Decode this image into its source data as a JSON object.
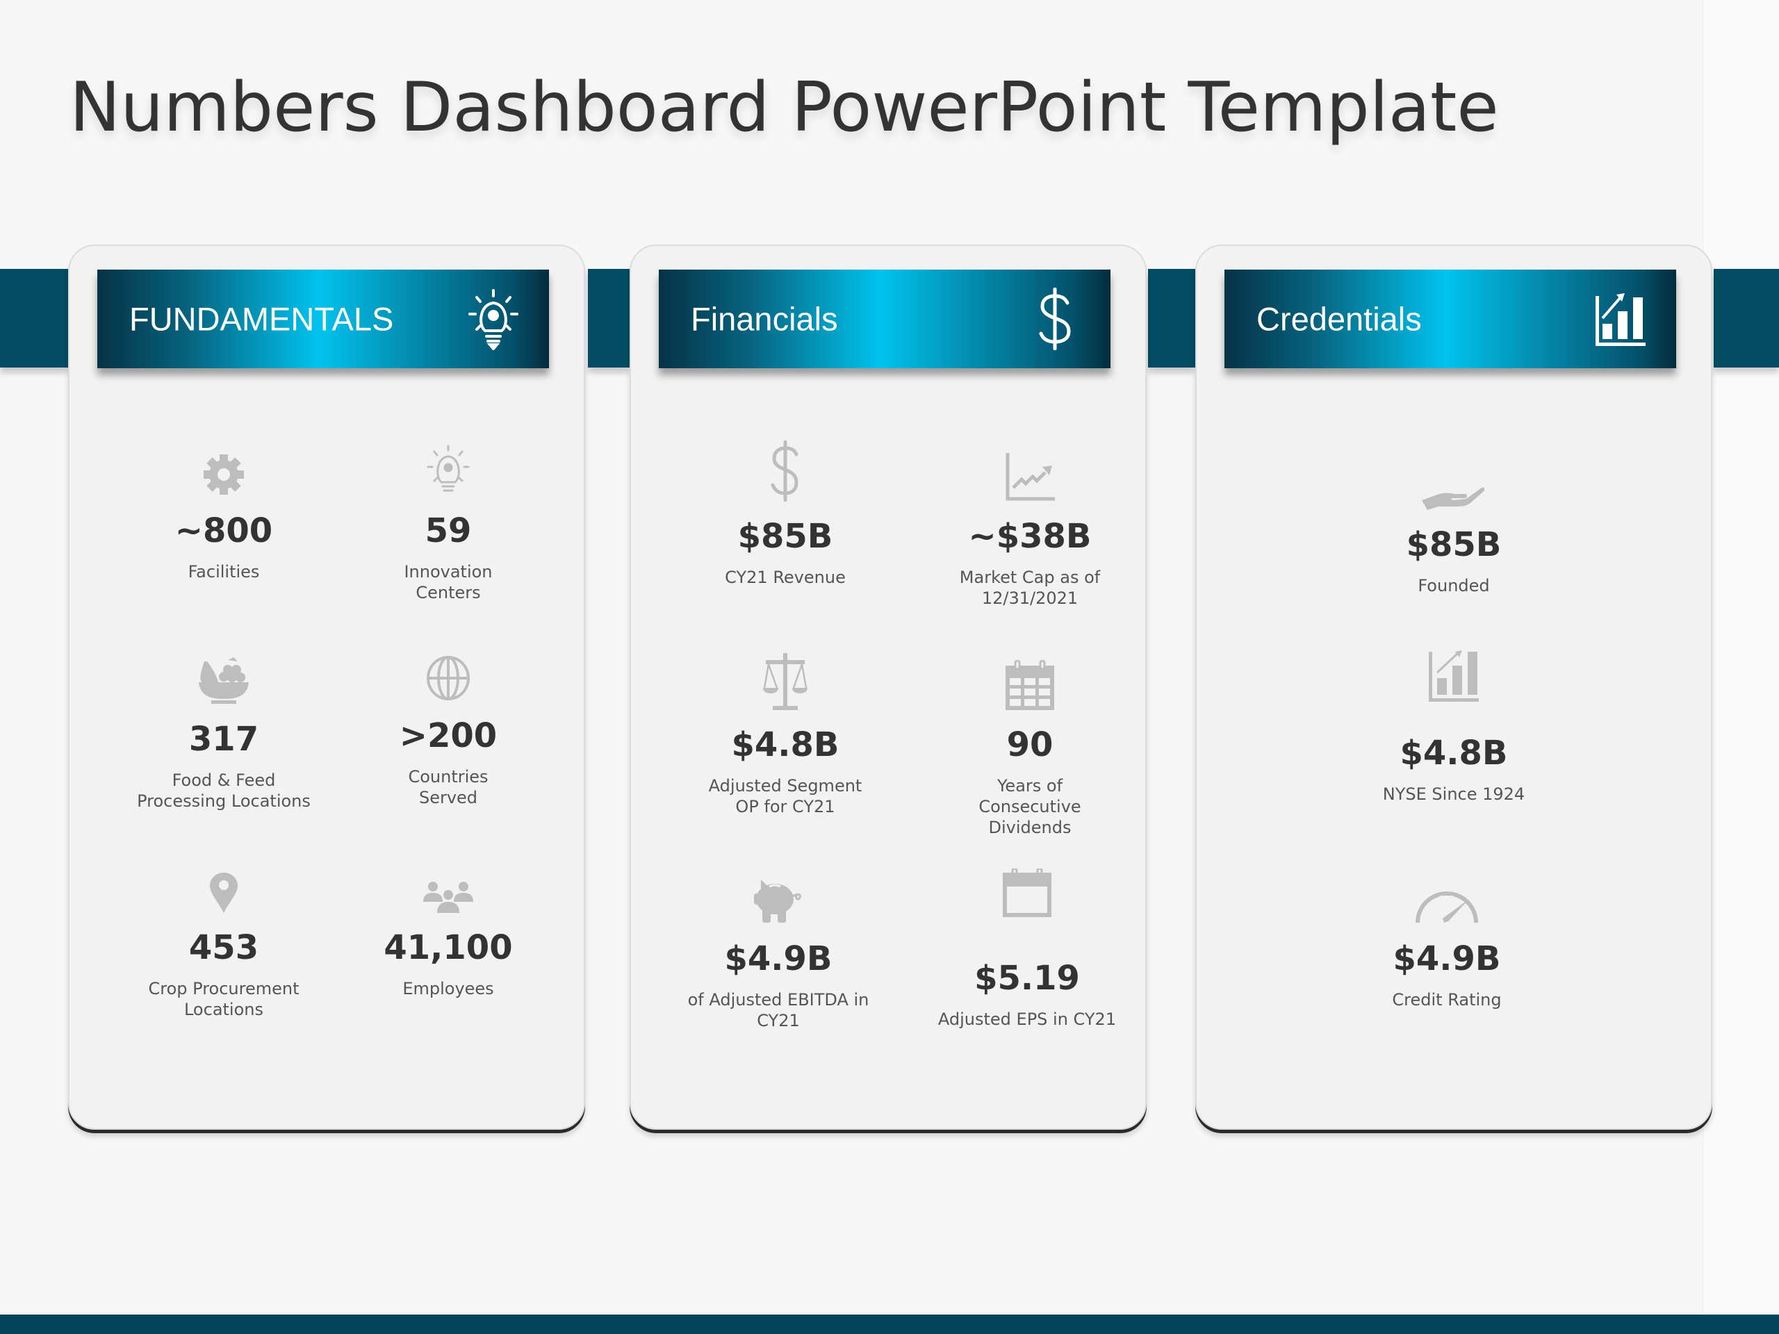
{
  "title": "Numbers Dashboard PowerPoint Template",
  "colors": {
    "accent_dark": "#044c63",
    "accent_bright": "#00c3ee",
    "icon_gray": "#bdbdbd",
    "value_text": "#333333",
    "label_text": "#555555"
  },
  "cards": [
    {
      "title": "FUNDAMENTALS",
      "icon": "lightbulb-gear-icon",
      "stats": [
        {
          "icon": "gear-icon",
          "value": "~800",
          "label": "Facilities"
        },
        {
          "icon": "lightbulb-icon",
          "value": "59",
          "label": "Innovation\nCenters"
        },
        {
          "icon": "fruit-bowl-icon",
          "value": "317",
          "label": "Food & Feed\nProcessing Locations"
        },
        {
          "icon": "globe-icon",
          "value": ">200",
          "label": "Countries\nServed"
        },
        {
          "icon": "location-pin-icon",
          "value": "453",
          "label": "Crop Procurement\nLocations"
        },
        {
          "icon": "people-icon",
          "value": "41,100",
          "label": "Employees"
        }
      ]
    },
    {
      "title": "Financials",
      "icon": "dollar-icon",
      "stats": [
        {
          "icon": "dollar-icon",
          "value": "$85B",
          "label": "CY21 Revenue"
        },
        {
          "icon": "line-chart-icon",
          "value": "~$38B",
          "label": "Market Cap as of\n12/31/2021"
        },
        {
          "icon": "scales-icon",
          "value": "$4.8B",
          "label": "Adjusted Segment\nOP for CY21"
        },
        {
          "icon": "calendar-grid-icon",
          "value": "90",
          "label": "Years of\nConsecutive\nDividends"
        },
        {
          "icon": "piggy-bank-icon",
          "value": "$4.9B",
          "label": "of Adjusted EBITDA in\nCY21"
        },
        {
          "icon": "calendar-icon",
          "value": "$5.19",
          "label": "Adjusted EPS in CY21"
        }
      ]
    },
    {
      "title": "Credentials",
      "icon": "bar-chart-growth-icon",
      "stats": [
        {
          "icon": "open-hand-icon",
          "value": "$85B",
          "label": "Founded"
        },
        {
          "icon": "bar-chart-growth-icon",
          "value": "$4.8B",
          "label": "NYSE Since 1924"
        },
        {
          "icon": "speedometer-icon",
          "value": "$4.9B",
          "label": "Credit Rating"
        }
      ]
    }
  ]
}
